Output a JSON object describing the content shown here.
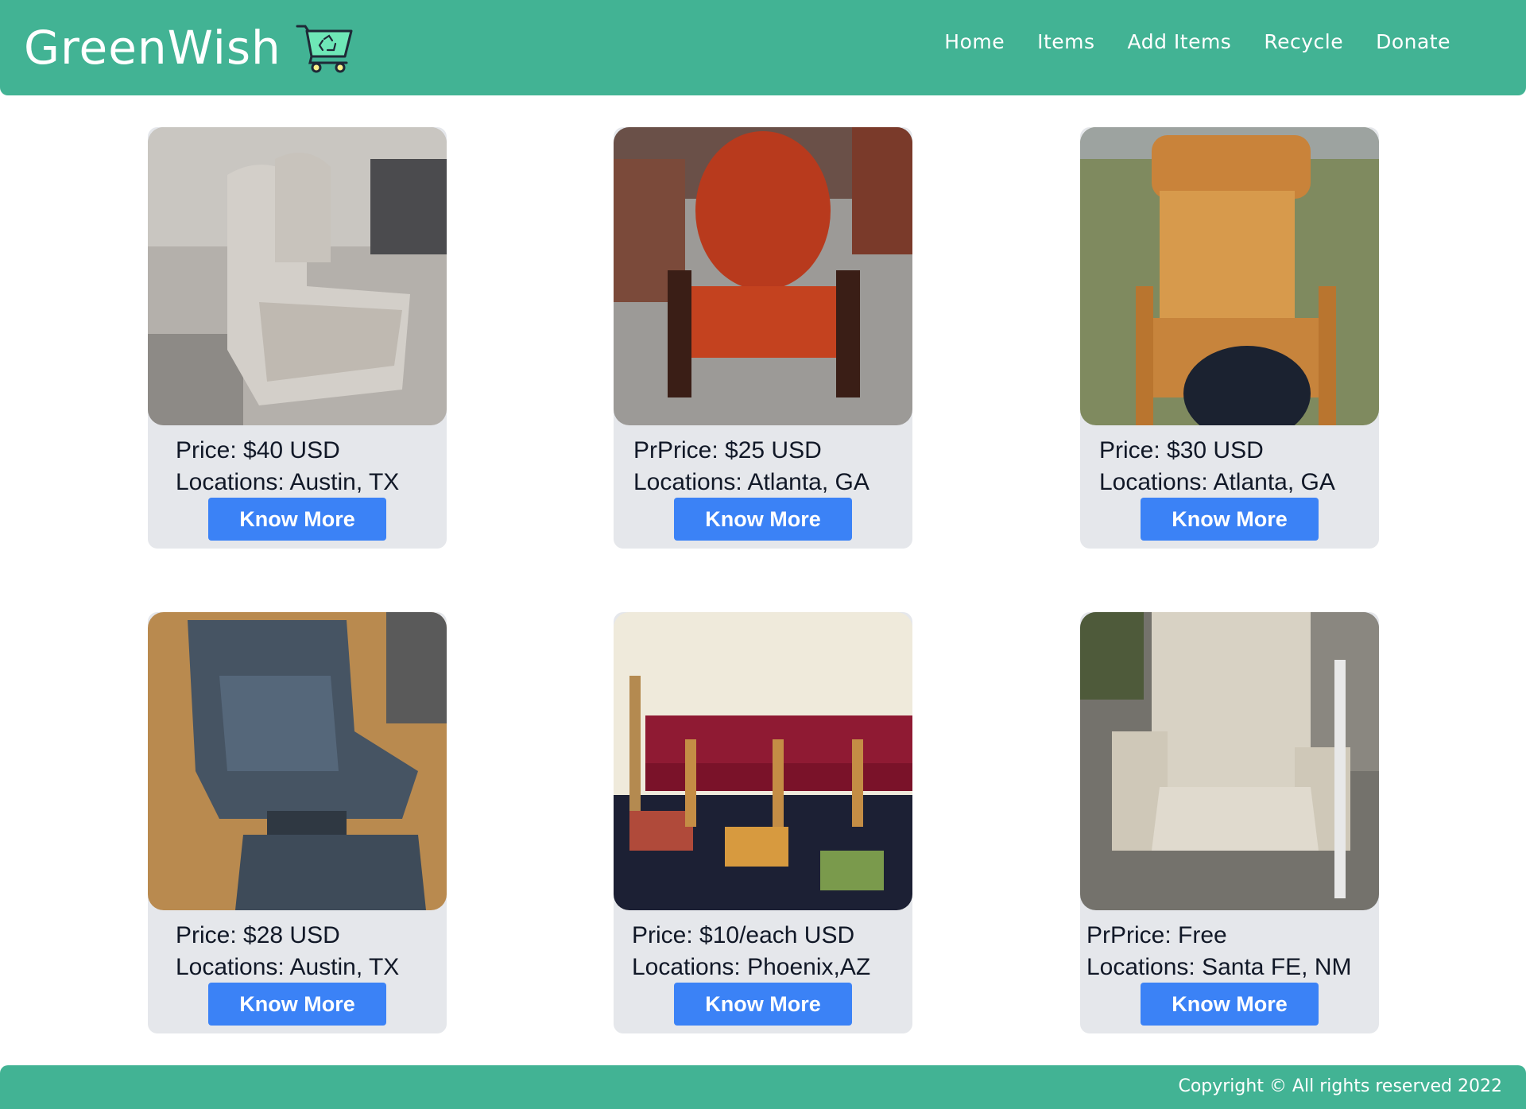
{
  "header": {
    "brand": "GreenWish",
    "brand_icon": "recycle-cart-icon",
    "nav": [
      "Home",
      "Items",
      "Add Items",
      "Recycle",
      "Donate"
    ]
  },
  "listings": [
    {
      "price": "Price: $40 USD",
      "location": "Locations: Austin, TX",
      "button": "Know More",
      "image": "grey-upholstered-chairs"
    },
    {
      "price": "PrPrice: $25 USD",
      "location": "Locations: Atlanta, GA",
      "button": "Know More",
      "image": "red-oval-back-armchair"
    },
    {
      "price": "Price: $30 USD",
      "location": "Locations: Atlanta, GA",
      "button": "Know More",
      "image": "carved-oak-rocking-chair"
    },
    {
      "price": "Price: $28 USD",
      "location": "Locations: Austin, TX",
      "button": "Know More",
      "image": "leather-recliner-with-ottoman"
    },
    {
      "price": "Price: $10/each USD",
      "location": "Locations: Phoenix,AZ",
      "button": "Know More",
      "image": "row-of-red-waiting-chairs"
    },
    {
      "price": "PrPrice: Free",
      "location": "Locations: Santa FE, NM",
      "button": "Know More",
      "image": "beige-glider-chair"
    }
  ],
  "footer": {
    "copyright": "Copyright © All rights reserved 2022"
  },
  "colors": {
    "primary": "#42b394",
    "button": "#3b82f6",
    "card": "#e5e7eb"
  }
}
